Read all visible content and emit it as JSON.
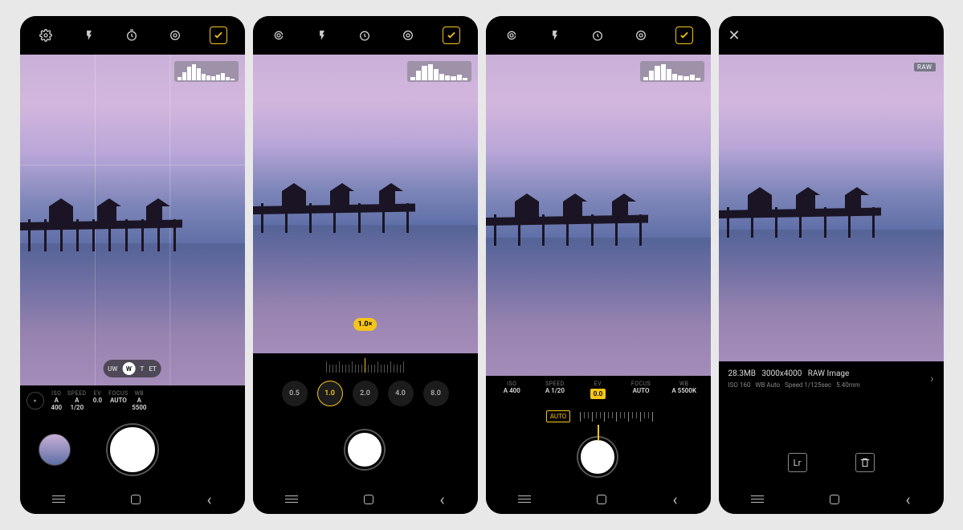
{
  "topbar_icons": [
    "settings",
    "flash",
    "timer",
    "metering",
    "raw-toggle"
  ],
  "screen1": {
    "lens": {
      "options": [
        "UW",
        "W",
        "T",
        "ET"
      ],
      "selected": "W"
    },
    "params": {
      "iso": {
        "label": "ISO",
        "value": "A 400"
      },
      "speed": {
        "label": "SPEED",
        "value": "A 1/20"
      },
      "ev": {
        "label": "EV",
        "value": "0.0"
      },
      "focus": {
        "label": "FOCUS",
        "value": "AUTO"
      },
      "wb": {
        "label": "WB",
        "value": "A 5500"
      }
    }
  },
  "screen2": {
    "zoom_current": "1.0×",
    "zoom_options": [
      "0.5",
      "1.0",
      "2.0",
      "4.0",
      "8.0"
    ],
    "zoom_selected": "1.0"
  },
  "screen3": {
    "params": {
      "iso": {
        "label": "ISO",
        "value": "A 400"
      },
      "speed": {
        "label": "SPEED",
        "value": "A 1/20"
      },
      "ev": {
        "label": "EV",
        "value": "0.0"
      },
      "focus": {
        "label": "FOCUS",
        "value": "AUTO"
      },
      "wb": {
        "label": "WB",
        "value": "A 5500K"
      }
    },
    "ev_auto": "AUTO"
  },
  "screen4": {
    "raw_badge": "RAW",
    "meta": {
      "line1_size": "28.3MB",
      "line1_res": "3000x4000",
      "line1_fmt": "RAW Image",
      "line2_iso": "ISO 160",
      "line2_wb": "WB Auto",
      "line2_spd": "Speed 1/125sec",
      "line2_fl": "5.40mm"
    },
    "actions": {
      "export": "Lr",
      "delete": "delete"
    }
  }
}
